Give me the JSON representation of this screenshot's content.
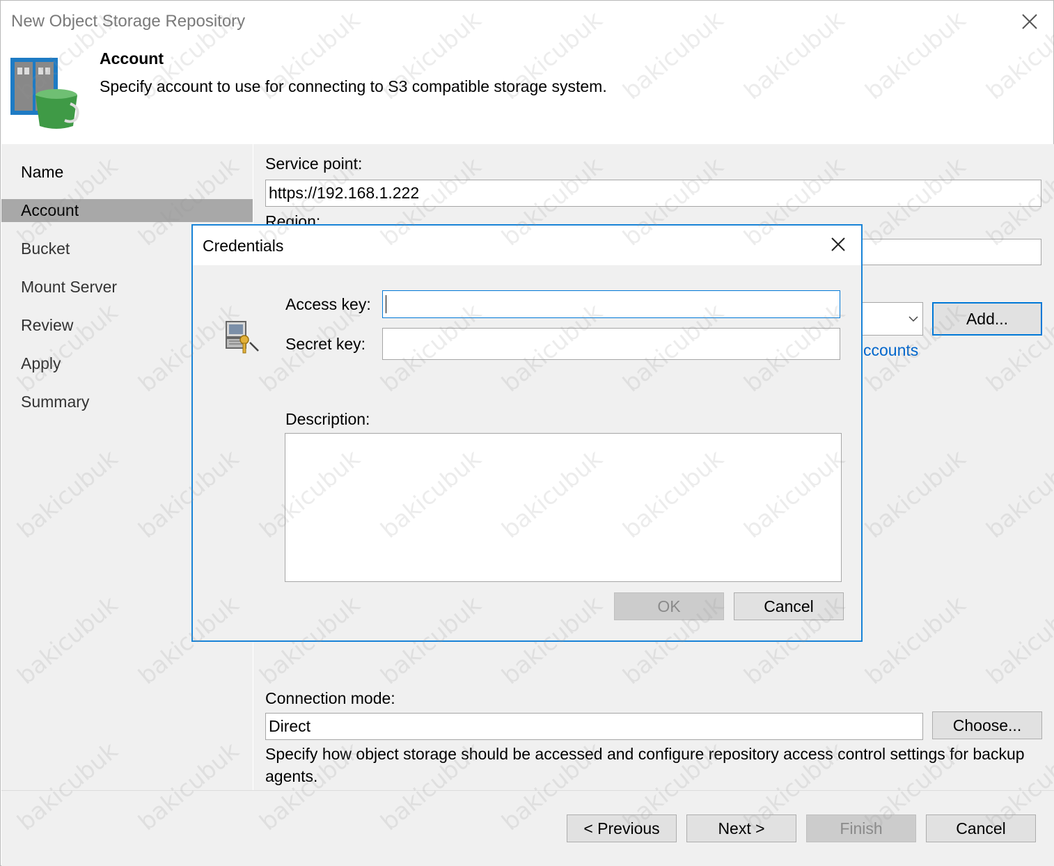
{
  "window": {
    "title": "New Object Storage Repository"
  },
  "header": {
    "title": "Account",
    "description": "Specify account to use for connecting to S3 compatible storage system."
  },
  "sidebar": {
    "items": [
      {
        "label": "Name"
      },
      {
        "label": "Account"
      },
      {
        "label": "Bucket"
      },
      {
        "label": "Mount Server"
      },
      {
        "label": "Review"
      },
      {
        "label": "Apply"
      },
      {
        "label": "Summary"
      }
    ],
    "active_item": "Account"
  },
  "main": {
    "service_point_label": "Service point:",
    "service_point_value": "https://192.168.1.222",
    "region_label": "Region:",
    "add_button": "Add...",
    "manage_accounts_link": "ccounts",
    "connection_mode_label": "Connection mode:",
    "connection_mode_value": "Direct",
    "choose_button": "Choose...",
    "connection_mode_help": "Specify how object storage should be accessed and configure repository access control settings for backup agents."
  },
  "dialog": {
    "title": "Credentials",
    "access_key_label": "Access key:",
    "access_key_value": "",
    "secret_key_label": "Secret key:",
    "secret_key_value": "",
    "description_label": "Description:",
    "description_value": "",
    "ok_button": "OK",
    "cancel_button": "Cancel"
  },
  "footer": {
    "previous_button": "< Previous",
    "next_button": "Next >",
    "finish_button": "Finish",
    "cancel_button": "Cancel"
  },
  "watermark": "bakicubuk",
  "colors": {
    "accent": "#0078d7",
    "dialog_border": "#1883d7",
    "link": "#0066cc",
    "active_nav": "#a8a8a8"
  }
}
